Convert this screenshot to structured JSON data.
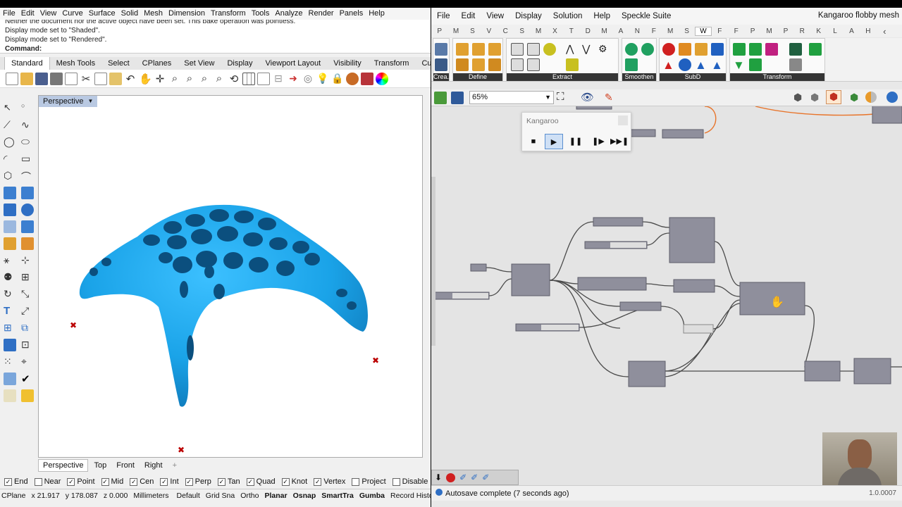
{
  "rhino": {
    "menu": [
      "File",
      "Edit",
      "View",
      "Curve",
      "Surface",
      "Solid",
      "Mesh",
      "Dimension",
      "Transform",
      "Tools",
      "Analyze",
      "Render",
      "Panels",
      "Help"
    ],
    "command_history": [
      "Neither the document nor the active object have been set. This bake operation was pointless.",
      "Display mode set to \"Shaded\".",
      "Display mode set to \"Rendered\"."
    ],
    "command_label": "Command:",
    "toolbar_tabs": [
      "Standard",
      "Mesh Tools",
      "Select",
      "CPlanes",
      "Set View",
      "Display",
      "Viewport Layout",
      "Visibility",
      "Transform",
      "Curve To"
    ],
    "active_toolbar_tab": "Standard",
    "viewport_title": "Perspective",
    "viewport_tabs": [
      "Perspective",
      "Top",
      "Front",
      "Right"
    ],
    "add_viewport_tab": "+",
    "mesh_color": "#1aa3e8",
    "osnaps": [
      {
        "label": "End",
        "checked": true
      },
      {
        "label": "Near",
        "checked": false
      },
      {
        "label": "Point",
        "checked": true
      },
      {
        "label": "Mid",
        "checked": true
      },
      {
        "label": "Cen",
        "checked": true
      },
      {
        "label": "Int",
        "checked": true
      },
      {
        "label": "Perp",
        "checked": true
      },
      {
        "label": "Tan",
        "checked": true
      },
      {
        "label": "Quad",
        "checked": true
      },
      {
        "label": "Knot",
        "checked": true
      },
      {
        "label": "Vertex",
        "checked": true
      },
      {
        "label": "Project",
        "checked": false
      },
      {
        "label": "Disable",
        "checked": false
      }
    ],
    "status": {
      "cplane": "CPlane",
      "x": "x 21.917",
      "y": "y 178.087",
      "z": "z 0.000",
      "units": "Millimeters",
      "layer": "Default",
      "toggles": [
        "Grid Sna",
        "Ortho",
        "Planar",
        "Osnap",
        "SmartTra",
        "Gumba",
        "Record Histo"
      ]
    }
  },
  "grasshopper": {
    "menu": [
      "File",
      "Edit",
      "View",
      "Display",
      "Solution",
      "Help",
      "Speckle Suite"
    ],
    "title": "Kangaroo flobby mesh",
    "tab_letters": [
      "P",
      "M",
      "S",
      "V",
      "C",
      "S",
      "M",
      "X",
      "T",
      "D",
      "M",
      "A",
      "N",
      "F",
      "M",
      "S",
      "W",
      "F",
      "F",
      "P",
      "M",
      "P",
      "R",
      "K",
      "L",
      "A",
      "H"
    ],
    "active_tab_letter": "W",
    "ribbon_groups": [
      "Crea...",
      "Define",
      "Extract",
      "Smoothen",
      "SubD",
      "Transform"
    ],
    "zoom": "65%",
    "kangaroo": {
      "title": "Kangaroo",
      "buttons": [
        "stop",
        "play",
        "pause",
        "step",
        "end"
      ]
    },
    "autosave": "Autosave complete (7 seconds ago)",
    "version": "1.0.0007"
  }
}
